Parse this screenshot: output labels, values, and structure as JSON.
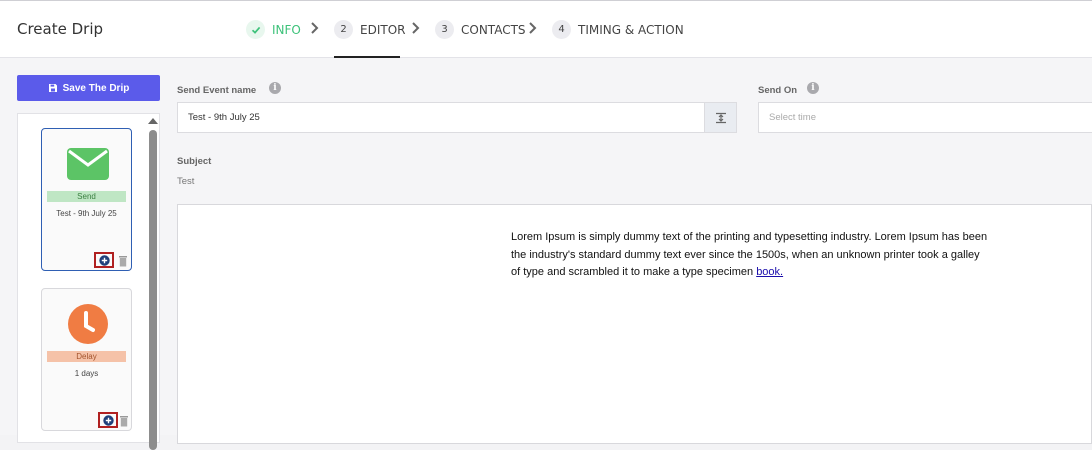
{
  "header": {
    "title": "Create Drip",
    "steps": [
      {
        "num": "✓",
        "label": "INFO"
      },
      {
        "num": "2",
        "label": "EDITOR"
      },
      {
        "num": "3",
        "label": "CONTACTS"
      },
      {
        "num": "4",
        "label": "TIMING & ACTION"
      }
    ]
  },
  "sidebar": {
    "save_label": "Save The Drip",
    "cards": [
      {
        "type": "Send",
        "detail": "Test - 9th July 25",
        "icon": "envelope-icon",
        "color": "#5cc466",
        "band": "#bfe6c4"
      },
      {
        "type": "Delay",
        "detail": "1 days",
        "icon": "clock-icon",
        "color": "#f07c43",
        "band": "#f5c2a8"
      }
    ]
  },
  "form": {
    "event_name_label": "Send Event name",
    "event_name_value": "Test - 9th July 25",
    "send_on_label": "Send On",
    "send_on_placeholder": "Select time",
    "subject_label": "Subject",
    "subject_value": "Test"
  },
  "editor": {
    "body_text": "Lorem Ipsum is simply dummy text of the printing and typesetting industry. Lorem Ipsum has been the industry's standard dummy text ever since the 1500s, when an unknown printer took a galley of type and scrambled it to make a type specimen ",
    "link_text": "book."
  },
  "colors": {
    "accent": "#5b5bea",
    "done_green": "#3dc27a"
  }
}
